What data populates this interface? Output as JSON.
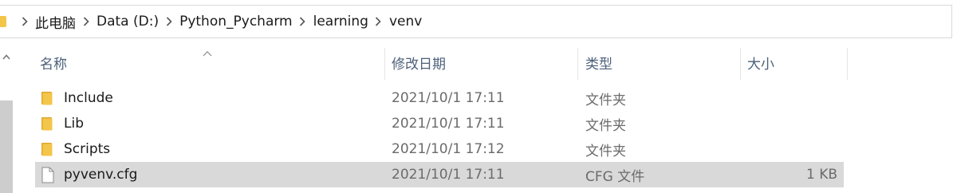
{
  "breadcrumb": [
    "此电脑",
    "Data (D:)",
    "Python_Pycharm",
    "learning",
    "venv"
  ],
  "columns": {
    "name": "名称",
    "modified": "修改日期",
    "type": "类型",
    "size": "大小"
  },
  "files": [
    {
      "name": "Include",
      "modified": "2021/10/1 17:11",
      "type": "文件夹",
      "size": "",
      "kind": "folder"
    },
    {
      "name": "Lib",
      "modified": "2021/10/1 17:11",
      "type": "文件夹",
      "size": "",
      "kind": "folder"
    },
    {
      "name": "Scripts",
      "modified": "2021/10/1 17:12",
      "type": "文件夹",
      "size": "",
      "kind": "folder"
    },
    {
      "name": "pyvenv.cfg",
      "modified": "2021/10/1 17:11",
      "type": "CFG 文件",
      "size": "1 KB",
      "kind": "file"
    }
  ],
  "colors": {
    "folder": "#f3c64a",
    "folder_dark": "#e0a82e",
    "selected_row": "#d9d9d9",
    "header_text": "#4c607a"
  },
  "icons": {
    "folder": "folder-icon",
    "file": "file-icon",
    "separator": "chevron-right-icon",
    "sort": "sort-ascending-icon"
  }
}
